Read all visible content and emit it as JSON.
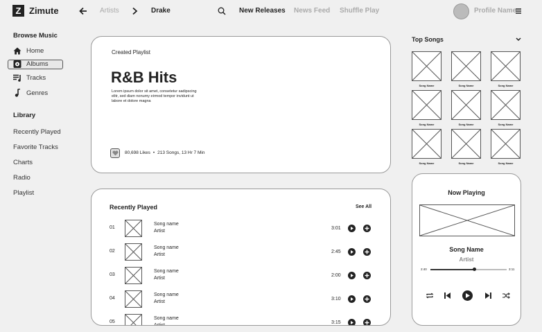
{
  "header": {
    "logo_letter": "Z",
    "app_name": "Zimute",
    "breadcrumb": [
      "Artists",
      "Drake"
    ],
    "nav": [
      {
        "label": "New Releases",
        "active": true
      },
      {
        "label": "News Feed",
        "active": false
      },
      {
        "label": "Shuffle Play",
        "active": false
      }
    ],
    "profile_name": "Profile Name"
  },
  "sidebar": {
    "browse_title": "Browse Music",
    "browse_items": [
      {
        "label": "Home",
        "icon": "home-icon"
      },
      {
        "label": "Albums",
        "icon": "album-icon",
        "selected": true
      },
      {
        "label": "Tracks",
        "icon": "tracks-icon"
      },
      {
        "label": "Genres",
        "icon": "genres-icon"
      }
    ],
    "library_title": "Library",
    "library_items": [
      "Recently Played",
      "Favorite Tracks",
      "Charts",
      "Radio",
      "Playlist"
    ]
  },
  "playlist": {
    "kicker": "Created Playlist",
    "title": "R&B Hits",
    "description": "Lorem ipsum dolor sit amet, consetetur sadipscing elitr, sed diam nonumy eirmod tempor invidunt ut labore et dolore magna",
    "likes": "80,698 Likes",
    "separator": "•",
    "meta": "213 Songs, 13 Hr 7 Min"
  },
  "recent": {
    "title": "Recently Played",
    "see_all": "See All",
    "rows": [
      {
        "num": "01",
        "song": "Song name",
        "artist": "Artist",
        "duration": "3:01"
      },
      {
        "num": "02",
        "song": "Song name",
        "artist": "Artist",
        "duration": "2:45"
      },
      {
        "num": "03",
        "song": "Song name",
        "artist": "Artist",
        "duration": "2:00"
      },
      {
        "num": "04",
        "song": "Song name",
        "artist": "Artist",
        "duration": "3:10"
      },
      {
        "num": "05",
        "song": "Song name",
        "artist": "Artist",
        "duration": "3:15"
      }
    ]
  },
  "top_songs": {
    "title": "Top Songs",
    "items": [
      "Song Name",
      "Song Name",
      "Song Name",
      "Song Name",
      "Song Name",
      "Song Name",
      "Song Name",
      "Song Name",
      "Song Name"
    ]
  },
  "now_playing": {
    "title": "Now Playing",
    "song": "Song Name",
    "artist": "Artist",
    "elapsed": "2:40",
    "total": "3:11",
    "progress": 0.58
  }
}
